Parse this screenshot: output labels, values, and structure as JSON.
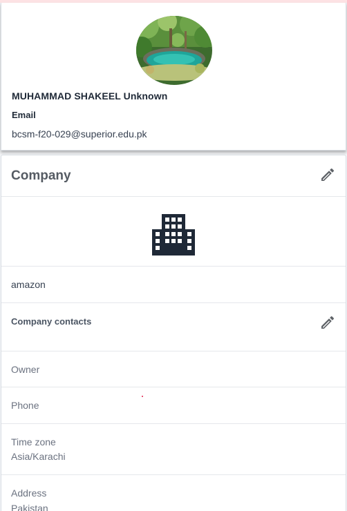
{
  "profile": {
    "name": "MUHAMMAD SHAKEEL Unknown",
    "email_label": "Email",
    "email": "bcsm-f20-029@superior.edu.pk"
  },
  "company": {
    "title": "Company",
    "name": "amazon",
    "contacts_title": "Company contacts",
    "fields": {
      "owner": {
        "label": "Owner"
      },
      "phone": {
        "label": "Phone"
      },
      "timezone": {
        "label": "Time zone",
        "value": "Asia/Karachi"
      },
      "address": {
        "label": "Address",
        "value": "Pakistan"
      }
    }
  },
  "icons": {
    "edit": "pencil-icon",
    "company": "building-icon"
  },
  "colors": {
    "icon_dark": "#1f2937",
    "pencil": "#5f6368",
    "border": "#e5e7eb"
  }
}
